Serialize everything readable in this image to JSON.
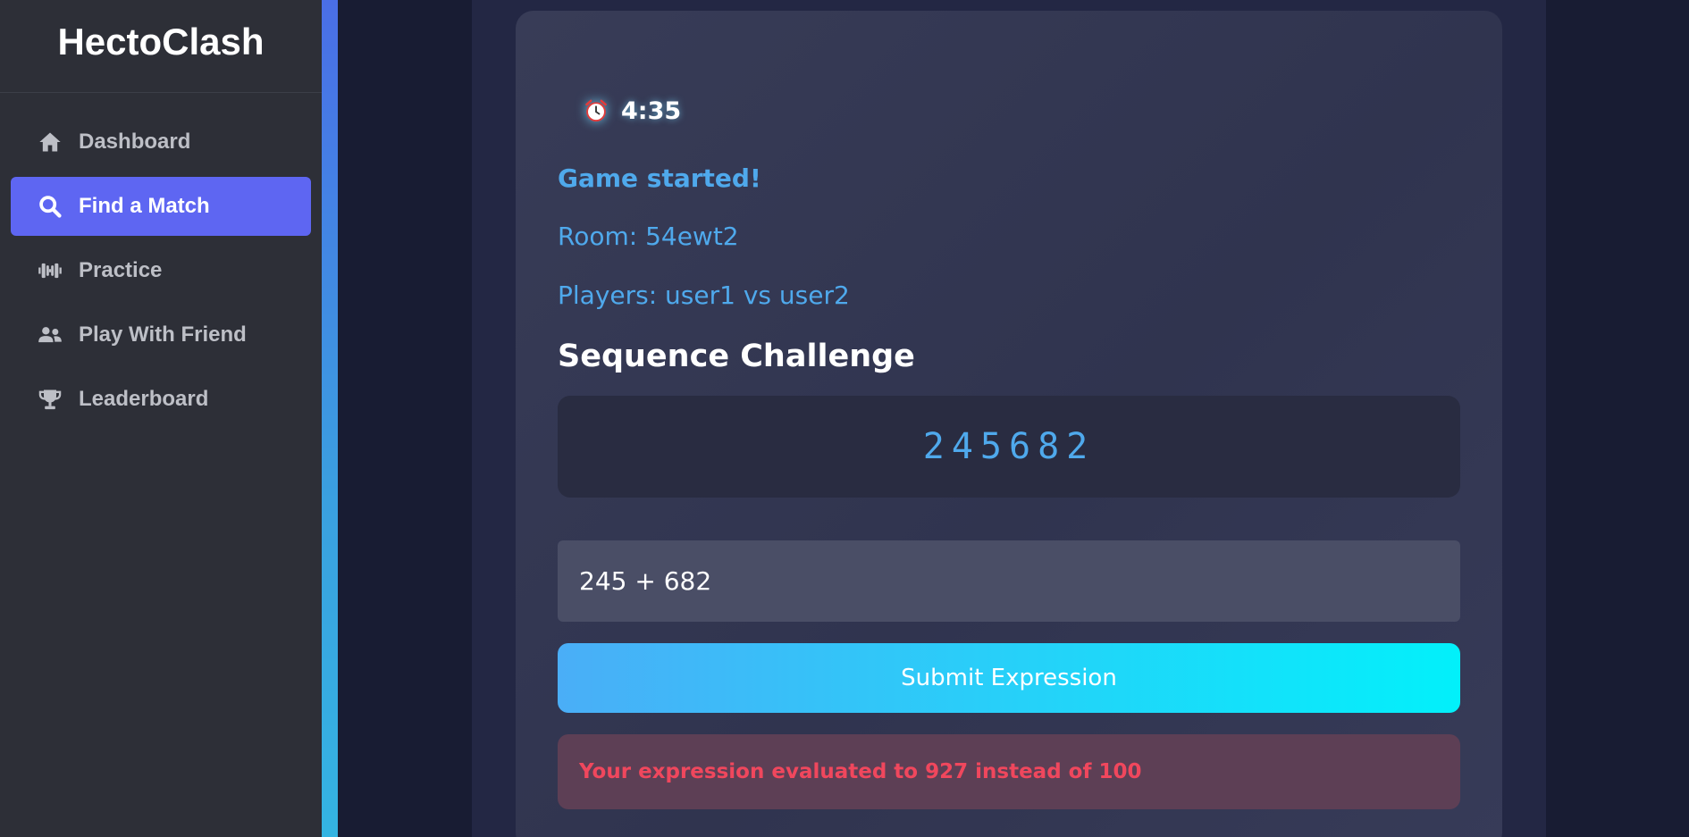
{
  "app": {
    "title": "HectoClash"
  },
  "sidebar": {
    "items": [
      {
        "label": "Dashboard",
        "icon": "home-icon",
        "active": false
      },
      {
        "label": "Find a Match",
        "icon": "search-icon",
        "active": true
      },
      {
        "label": "Practice",
        "icon": "dumbbell-icon",
        "active": false
      },
      {
        "label": "Play With Friend",
        "icon": "users-icon",
        "active": false
      },
      {
        "label": "Leaderboard",
        "icon": "trophy-icon",
        "active": false
      }
    ]
  },
  "game": {
    "timer": "4:35",
    "timer_icon": "alarm-clock-icon",
    "status": "Game started!",
    "room": "Room: 54ewt2",
    "players": "Players: user1 vs user2",
    "challenge_title": "Sequence Challenge",
    "sequence": "245682",
    "expression_value": "245 + 682",
    "submit_label": "Submit Expression",
    "error_message": "Your expression evaluated to 927 instead of 100"
  },
  "colors": {
    "accent": "#5e66f2",
    "info_text": "#4fa9ec",
    "error_text": "#f0475d",
    "error_bg": "#5d3f55"
  }
}
